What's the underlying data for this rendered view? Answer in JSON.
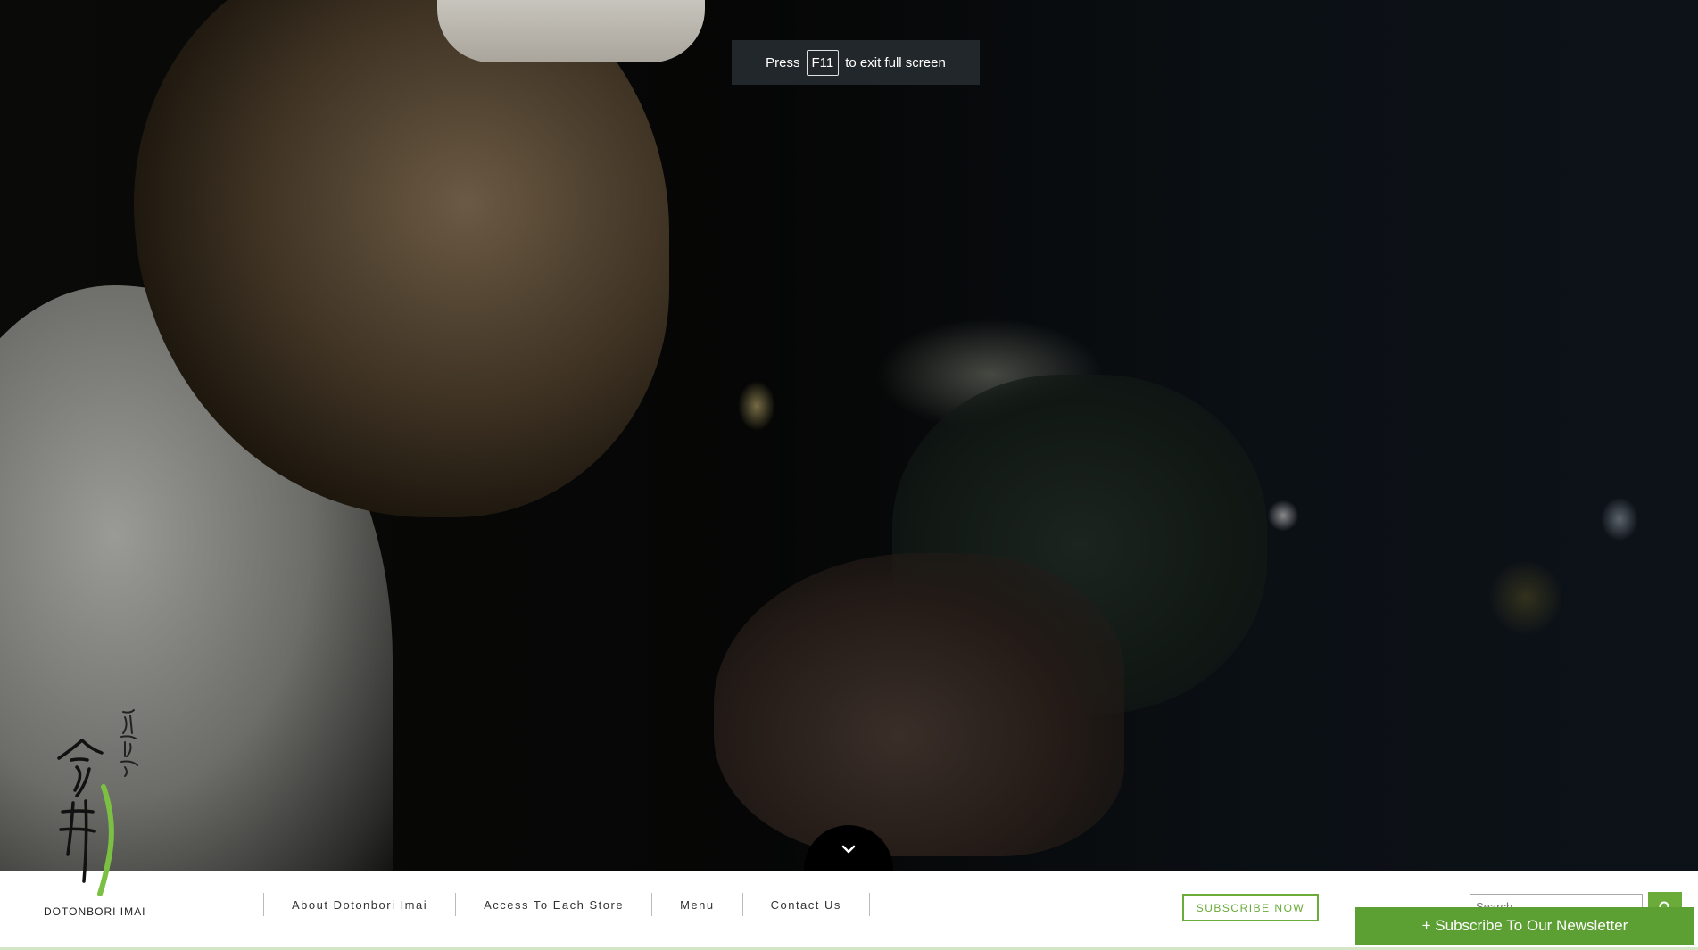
{
  "fullscreen_notice": {
    "prefix": "Press",
    "key": "F11",
    "suffix": "to exit full screen"
  },
  "logo": {
    "text": "DOTONBORI IMAI",
    "calligraphy": "道頓堀 今井"
  },
  "nav": {
    "items": [
      {
        "label": "About Dotonbori Imai"
      },
      {
        "label": "Access To Each Store"
      },
      {
        "label": "Menu"
      },
      {
        "label": "Contact Us"
      }
    ]
  },
  "subscribe_button": "SUBSCRIBE NOW",
  "search": {
    "placeholder": "Search ..."
  },
  "newsletter": {
    "label": "+ Subscribe To Our Newsletter"
  },
  "icons": {
    "scroll": "chevron-down-icon",
    "search": "search-icon"
  },
  "colors": {
    "accent": "#6aab3a",
    "newsletter_bg": "#5c9f33",
    "notice_bg": "#22272b"
  }
}
